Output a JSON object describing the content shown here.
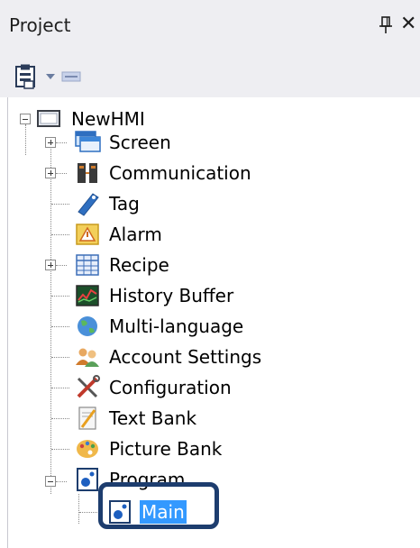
{
  "panel": {
    "title": "Project",
    "close_glyph": "✕"
  },
  "toolbar": {
    "buttons": [
      {
        "icon": "project-properties-icon"
      },
      {
        "icon": "dropdown-arrow-icon"
      },
      {
        "icon": "collapse-icon"
      }
    ]
  },
  "tree": {
    "root": "NewHMI",
    "items": [
      {
        "label": "Screen",
        "icon": "screen-icon",
        "expandable": true
      },
      {
        "label": "Communication",
        "icon": "communication-icon",
        "expandable": true
      },
      {
        "label": "Tag",
        "icon": "tag-icon",
        "expandable": false
      },
      {
        "label": "Alarm",
        "icon": "alarm-icon",
        "expandable": false
      },
      {
        "label": "Recipe",
        "icon": "recipe-icon",
        "expandable": true
      },
      {
        "label": "History Buffer",
        "icon": "history-buffer-icon",
        "expandable": false
      },
      {
        "label": "Multi-language",
        "icon": "globe-icon",
        "expandable": false
      },
      {
        "label": "Account Settings",
        "icon": "users-icon",
        "expandable": false
      },
      {
        "label": "Configuration",
        "icon": "tools-icon",
        "expandable": false
      },
      {
        "label": "Text Bank",
        "icon": "text-bank-icon",
        "expandable": false
      },
      {
        "label": "Picture Bank",
        "icon": "picture-bank-icon",
        "expandable": false
      },
      {
        "label": "Program",
        "icon": "program-icon",
        "expandable": true,
        "expanded": true
      }
    ],
    "program_children": [
      {
        "label": "Main",
        "icon": "program-icon",
        "selected": true
      }
    ]
  },
  "colors": {
    "selection": "#3399ff",
    "highlight_border": "#1d3d6e",
    "chrome": "#eeeef2"
  }
}
